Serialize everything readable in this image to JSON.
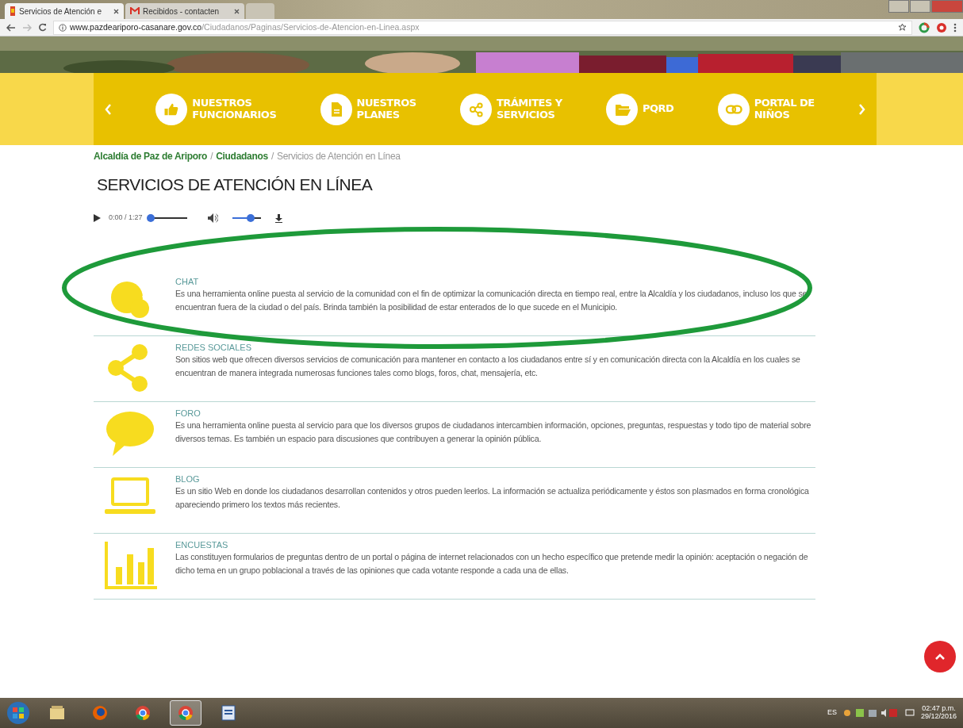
{
  "browser": {
    "tabs": [
      {
        "title": "Servicios de Atención e",
        "kind": "site",
        "selected": true
      },
      {
        "title": "Recibidos - contacten",
        "kind": "mail",
        "selected": false
      },
      {
        "kind": "new",
        "selected": false
      }
    ],
    "url_host": "www.pazdeariporo-casanare.gov.co",
    "url_path": "/Ciudadanos/Paginas/Servicios-de-Atencion-en-Linea.aspx"
  },
  "nav": {
    "items": [
      {
        "label": "NUESTROS\nFUNCIONARIOS",
        "kind": "thumb"
      },
      {
        "label": "NUESTROS\nPLANES",
        "kind": "document"
      },
      {
        "label": "TRÁMITES Y\nSERVICIOS",
        "kind": "share"
      },
      {
        "label": "PQRD",
        "kind": "folder"
      },
      {
        "label": "PORTAL DE\nNIÑOS",
        "kind": "link"
      }
    ]
  },
  "breadcrumb": [
    {
      "label": "Alcaldía de Paz de Ariporo",
      "kind": "link"
    },
    {
      "label": "/",
      "kind": "sep"
    },
    {
      "label": "Ciudadanos",
      "kind": "link"
    },
    {
      "label": "/",
      "kind": "sep"
    },
    {
      "label": "Servicios de Atención en Línea",
      "kind": "current"
    }
  ],
  "title": "SERVICIOS DE ATENCIÓN EN LÍNEA",
  "audio": {
    "time": "0:00 / 1:27",
    "progress": {
      "level": 0
    },
    "volume": {
      "level": 0.65
    }
  },
  "services": [
    {
      "kind": "chat",
      "title": "CHAT",
      "description": "Es una herramienta online puesta al servicio de la comunidad con el fin de optimizar la comunicación directa en tiempo real, entre la Alcaldía y los ciudadanos, incluso los que se encuentran fuera de la ciudad o del país. Brinda también la posibilidad de estar enterados de lo que sucede en el Municipio."
    },
    {
      "kind": "share",
      "title": "REDES SOCIALES",
      "description": "Son sitios web que ofrecen diversos servicios de comunicación para mantener en contacto a los ciudadanos entre sí y en comunicación directa con la Alcaldía en los cuales se encuentran de manera integrada numerosas funciones tales como blogs, foros, chat, mensajería, etc."
    },
    {
      "kind": "comment",
      "title": "FORO",
      "description": "Es una herramienta online puesta al servicio para que los diversos grupos de ciudadanos intercambien información, opciones, preguntas, respuestas y todo tipo de material sobre diversos temas. Es también un espacio para discusiones que contribuyen a generar la opinión pública."
    },
    {
      "kind": "laptop",
      "title": "BLOG",
      "description": "Es un sitio Web en donde los ciudadanos desarrollan contenidos y otros pueden leerlos. La información se actualiza periódicamente y éstos son plasmados en forma cronológica apareciendo primero los textos más recientes."
    },
    {
      "kind": "chart",
      "title": "ENCUESTAS",
      "description": "Las constituyen formularios de preguntas dentro de un portal o página de internet relacionados con un hecho específico que pretende medir la opinión: aceptación o negación de dicho tema en un grupo poblacional a través de las opiniones que cada votante responde a cada una de ellas."
    }
  ],
  "taskbar": {
    "apps": [
      {
        "kind": "explorer",
        "selected": false
      },
      {
        "kind": "firefox",
        "selected": false
      },
      {
        "kind": "chrome",
        "selected": false
      },
      {
        "kind": "chrome",
        "selected": true
      },
      {
        "kind": "word",
        "selected": false
      }
    ],
    "language": "ES",
    "time": "02:47 p.m.",
    "date": "29/12/2016"
  }
}
